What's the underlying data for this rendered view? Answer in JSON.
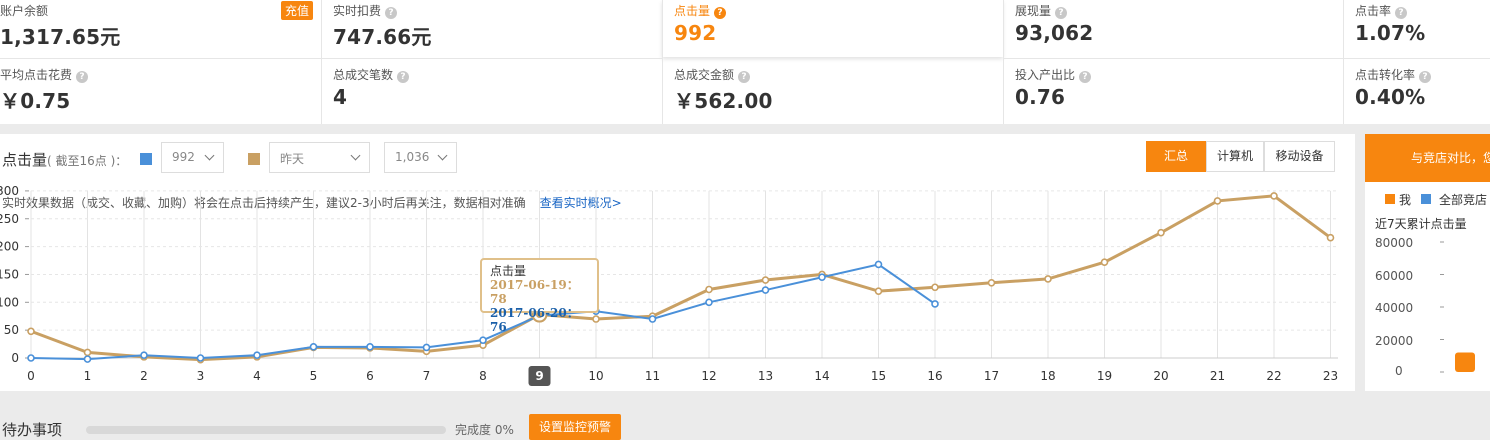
{
  "stats": [
    {
      "label": "账户余额",
      "value": "1,317.65元",
      "help": false,
      "badge": "充值"
    },
    {
      "label": "实时扣费",
      "value": "747.66元",
      "help": true
    },
    {
      "label": "点击量",
      "value": "992",
      "help": true,
      "active": true
    },
    {
      "label": "展现量",
      "value": "93,062",
      "help": true
    },
    {
      "label": "点击率",
      "value": "1.07%",
      "help": true
    },
    {
      "label": "平均点击花费",
      "value": "￥0.75",
      "help": true
    },
    {
      "label": "总成交笔数",
      "value": "4",
      "help": true
    },
    {
      "label": "总成交金额",
      "value": "￥562.00",
      "help": true
    },
    {
      "label": "投入产出比",
      "value": "0.76",
      "help": true
    },
    {
      "label": "点击转化率",
      "value": "0.40%",
      "help": true
    }
  ],
  "panel": {
    "title": "点击量",
    "title_note": "( 截至16点 )：",
    "series1_select": "992",
    "series2_select": "昨天",
    "series3_select": "1,036",
    "tabs": [
      "汇总",
      "计算机",
      "移动设备"
    ],
    "notice": "实时效果数据（成交、收藏、加购）将会在点击后持续产生，建议2-3小时后再关注，数据相对准确",
    "notice_link": "查看实时概况>"
  },
  "tooltip": {
    "title": "点击量",
    "line1": "2017-06-19：78",
    "line2": "2017-06-20：76"
  },
  "chart_data": {
    "type": "line",
    "x": [
      0,
      1,
      2,
      3,
      4,
      5,
      6,
      7,
      8,
      9,
      10,
      11,
      12,
      13,
      14,
      15,
      16,
      17,
      18,
      19,
      20,
      21,
      22,
      23
    ],
    "ylim": [
      0,
      300
    ],
    "yticks": [
      0,
      50,
      100,
      150,
      200,
      250,
      300
    ],
    "highlight_x": 9,
    "grid": true,
    "colors": {
      "today": "#4a90d9",
      "yesterday": "#c9a063"
    },
    "series": [
      {
        "key": "today",
        "values": [
          0,
          -2,
          5,
          0,
          5,
          20,
          20,
          19,
          32,
          76,
          84,
          70,
          100,
          122,
          145,
          168,
          97
        ]
      },
      {
        "key": "yesterday",
        "values": [
          48,
          10,
          2,
          -3,
          2,
          19,
          18,
          12,
          23,
          78,
          70,
          75,
          123,
          140,
          150,
          120,
          127,
          135,
          142,
          172,
          225,
          282,
          291,
          216
        ]
      }
    ]
  },
  "right_panel": {
    "header": "与竞店对比，您",
    "legend_me": "我",
    "legend_all": "全部竞店",
    "title": "近7天累计点击量",
    "ticks": [
      "80000",
      "60000",
      "40000",
      "20000",
      "0"
    ],
    "me_value": 12000,
    "colors": {
      "me": "#f7860f",
      "all": "#4a90d9"
    }
  },
  "bottom": {
    "title": "待办事项",
    "progress": 0,
    "progress_text": "完成度 0%",
    "button": "设置监控预警"
  }
}
